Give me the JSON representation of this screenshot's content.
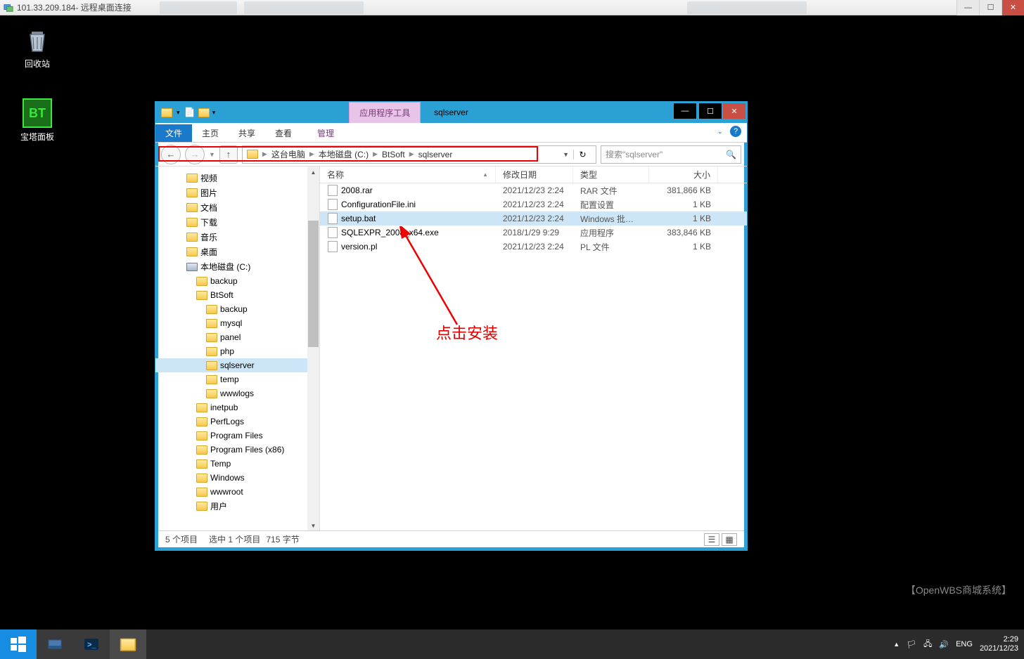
{
  "rdp": {
    "ip": "101.33.209.184",
    "title_suffix": " - 远程桌面连接"
  },
  "desktop_icons": {
    "recycle": "回收站",
    "bt_panel": "宝塔面板",
    "bt_text": "BT"
  },
  "explorer": {
    "tool_tab": "应用程序工具",
    "window_title": "sqlserver",
    "ribbon": {
      "file": "文件",
      "home": "主页",
      "share": "共享",
      "view": "查看",
      "manage": "管理"
    },
    "breadcrumb": {
      "b0": "这台电脑",
      "b1": "本地磁盘 (C:)",
      "b2": "BtSoft",
      "b3": "sqlserver"
    },
    "refresh_hint": "↻",
    "search_placeholder": "搜索\"sqlserver\"",
    "tree": [
      {
        "label": "视频",
        "icon": "folder",
        "indent": 44
      },
      {
        "label": "图片",
        "icon": "folder",
        "indent": 44
      },
      {
        "label": "文档",
        "icon": "folder",
        "indent": 44
      },
      {
        "label": "下载",
        "icon": "folder",
        "indent": 44
      },
      {
        "label": "音乐",
        "icon": "folder",
        "indent": 44
      },
      {
        "label": "桌面",
        "icon": "folder",
        "indent": 44
      },
      {
        "label": "本地磁盘 (C:)",
        "icon": "drive",
        "indent": 44
      },
      {
        "label": "backup",
        "icon": "folder",
        "indent": 58
      },
      {
        "label": "BtSoft",
        "icon": "folder",
        "indent": 58
      },
      {
        "label": "backup",
        "icon": "folder",
        "indent": 72
      },
      {
        "label": "mysql",
        "icon": "folder",
        "indent": 72
      },
      {
        "label": "panel",
        "icon": "folder",
        "indent": 72
      },
      {
        "label": "php",
        "icon": "folder",
        "indent": 72
      },
      {
        "label": "sqlserver",
        "icon": "folder",
        "indent": 72,
        "selected": true
      },
      {
        "label": "temp",
        "icon": "folder",
        "indent": 72
      },
      {
        "label": "wwwlogs",
        "icon": "folder",
        "indent": 72
      },
      {
        "label": "inetpub",
        "icon": "folder",
        "indent": 58
      },
      {
        "label": "PerfLogs",
        "icon": "folder",
        "indent": 58
      },
      {
        "label": "Program Files",
        "icon": "folder",
        "indent": 58
      },
      {
        "label": "Program Files (x86)",
        "icon": "folder",
        "indent": 58
      },
      {
        "label": "Temp",
        "icon": "folder",
        "indent": 58
      },
      {
        "label": "Windows",
        "icon": "folder",
        "indent": 58
      },
      {
        "label": "wwwroot",
        "icon": "folder",
        "indent": 58
      },
      {
        "label": "用户",
        "icon": "folder",
        "indent": 58
      }
    ],
    "columns": {
      "name": "名称",
      "date": "修改日期",
      "type": "类型",
      "size": "大小"
    },
    "files": [
      {
        "name": "2008.rar",
        "date": "2021/12/23 2:24",
        "type": "RAR 文件",
        "size": "381,866 KB",
        "icon": "file"
      },
      {
        "name": "ConfigurationFile.ini",
        "date": "2021/12/23 2:24",
        "type": "配置设置",
        "size": "1 KB",
        "icon": "file"
      },
      {
        "name": "setup.bat",
        "date": "2021/12/23 2:24",
        "type": "Windows 批处理...",
        "size": "1 KB",
        "icon": "file",
        "selected": true
      },
      {
        "name": "SQLEXPR_2008_x64.exe",
        "date": "2018/1/29 9:29",
        "type": "应用程序",
        "size": "383,846 KB",
        "icon": "file"
      },
      {
        "name": "version.pl",
        "date": "2021/12/23 2:24",
        "type": "PL 文件",
        "size": "1 KB",
        "icon": "file"
      }
    ],
    "status": {
      "items": "5 个项目",
      "selected": "选中 1 个项目",
      "size": "715 字节"
    }
  },
  "annotation": {
    "text": "点击安装"
  },
  "tray": {
    "lang": "ENG",
    "time": "2:29",
    "date": "2021/12/23"
  },
  "watermark": "【OpenWBS商城系统】"
}
